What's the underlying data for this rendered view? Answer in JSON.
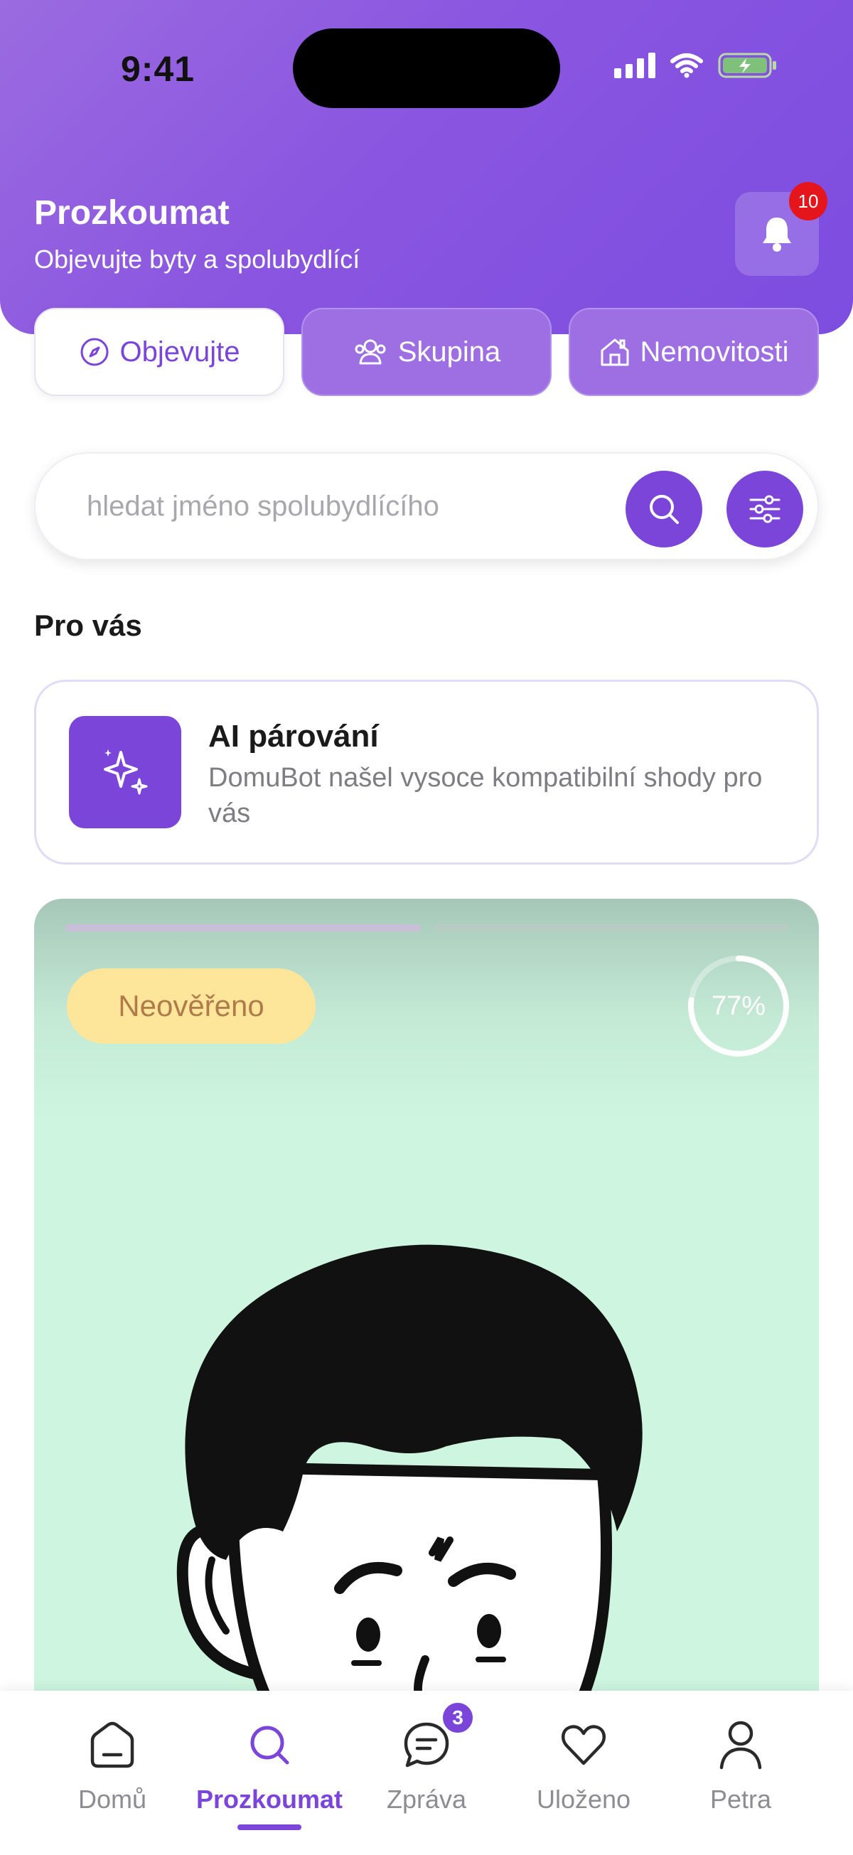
{
  "status_bar": {
    "time": "9:41"
  },
  "header": {
    "title": "Prozkoumat",
    "subtitle": "Objevujte byty a spolubydlící",
    "notification_count": "10"
  },
  "tabs": [
    {
      "label": "Objevujte",
      "icon": "compass-icon",
      "active": true
    },
    {
      "label": "Skupina",
      "icon": "group-icon",
      "active": false
    },
    {
      "label": "Nemovitosti",
      "icon": "house-icon",
      "active": false
    }
  ],
  "search": {
    "placeholder": "hledat jméno spolubydlícího"
  },
  "section": {
    "title": "Pro vás"
  },
  "ai_card": {
    "title": "AI párování",
    "description": "DomuBot našel vysoce kompatibilní shody pro vás",
    "icon": "sparkles-icon"
  },
  "profile_card": {
    "status_badge": "Neověřeno",
    "match_percent_label": "77%",
    "match_percent": 77,
    "photo_index": 1,
    "photo_count": 2
  },
  "bottom_nav": {
    "items": [
      {
        "label": "Domů",
        "icon": "home-icon"
      },
      {
        "label": "Prozkoumat",
        "icon": "search-icon",
        "active": true
      },
      {
        "label": "Zpráva",
        "icon": "chat-icon",
        "badge": "3"
      },
      {
        "label": "Uloženo",
        "icon": "heart-icon"
      },
      {
        "label": "Petra",
        "icon": "user-icon"
      }
    ]
  },
  "colors": {
    "accent": "#7c45d9",
    "header": "#8a55e0",
    "card_bg": "#cdf5df",
    "badge_yellow": "#fde69a",
    "notification_red": "#e4161c"
  }
}
